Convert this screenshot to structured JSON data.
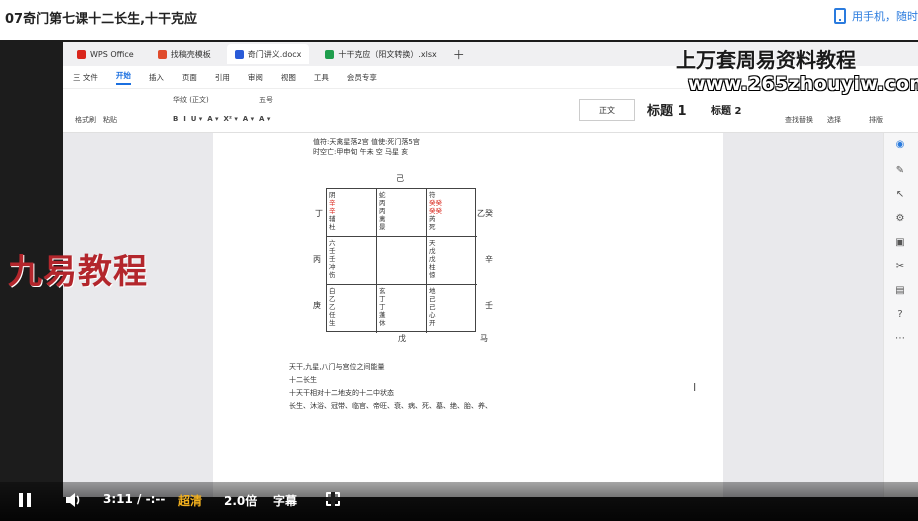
{
  "header": {
    "title": "07奇门第七课十二长生,十干克应",
    "mobile_link": "用手机，随时"
  },
  "watermarks": {
    "title": "上万套周易资料教程",
    "site": "www.265zhouyiw.com",
    "left": "九易教程"
  },
  "wps": {
    "tabs": [
      {
        "label": "WPS Office",
        "color": "#d9261c"
      },
      {
        "label": "找稿壳模板",
        "color": "#e04b2c"
      },
      {
        "label": "奇门讲义.docx",
        "color": "#2a5bd8"
      },
      {
        "label": "十干克应（阳文转换）.xlsx",
        "color": "#1f9e4d"
      }
    ],
    "menu": [
      "三 文件",
      "开始",
      "插入",
      "页面",
      "引用",
      "审阅",
      "视图",
      "工具",
      "会员专享"
    ],
    "menu_active": "开始",
    "ribbon": {
      "paste_labels": [
        "格式刷",
        "粘贴"
      ],
      "font_name": "华纹 (正文)",
      "font_size": "五号",
      "style_normal": "正文",
      "style_h1": "标题 1",
      "style_h2": "标题 2",
      "find_replace": "查找替换",
      "select": "选择",
      "layout": "排版"
    }
  },
  "document": {
    "header_lines": [
      "值符:天禽星落2宫 值使:死门落5宫",
      "时空亡:甲申旬 午未 空 马星 亥"
    ],
    "directions": {
      "top": "己",
      "left_top": "丁",
      "left_mid": "丙",
      "left_bottom": "庚",
      "right_top": "乙癸",
      "right_mid": "辛",
      "right_bottom": "壬",
      "bottom": "戊",
      "bottom_red": "马"
    },
    "cells": [
      [
        "阴",
        "辛",
        "辛",
        "辅",
        "杜"
      ],
      [
        "蛇",
        "丙",
        "丙",
        "禽",
        "景"
      ],
      [
        "符",
        "癸癸",
        "癸癸",
        "芮",
        "死"
      ],
      [
        "六",
        "壬",
        "壬",
        "冲",
        "伤"
      ],
      [
        "",
        "",
        "",
        "",
        ""
      ],
      [
        "天",
        "戊",
        "戊",
        "柱",
        "惊"
      ],
      [
        "白",
        "乙",
        "乙",
        "任",
        "生"
      ],
      [
        "玄",
        "丁",
        "丁",
        "蓬",
        "休"
      ],
      [
        "地",
        "己",
        "己",
        "心",
        "开"
      ]
    ],
    "notes": [
      "天干,九星,八门与宫位之间能量",
      "十二长生",
      "十天干相对十二地支的十二中状态",
      "长生、沐浴、冠带、临官、帝旺、衰、病、死、墓、绝、胎、养、"
    ]
  },
  "player": {
    "time": "3:11 / -:--",
    "quality": "超清",
    "speed": "2.0倍",
    "subtitle": "字幕"
  }
}
